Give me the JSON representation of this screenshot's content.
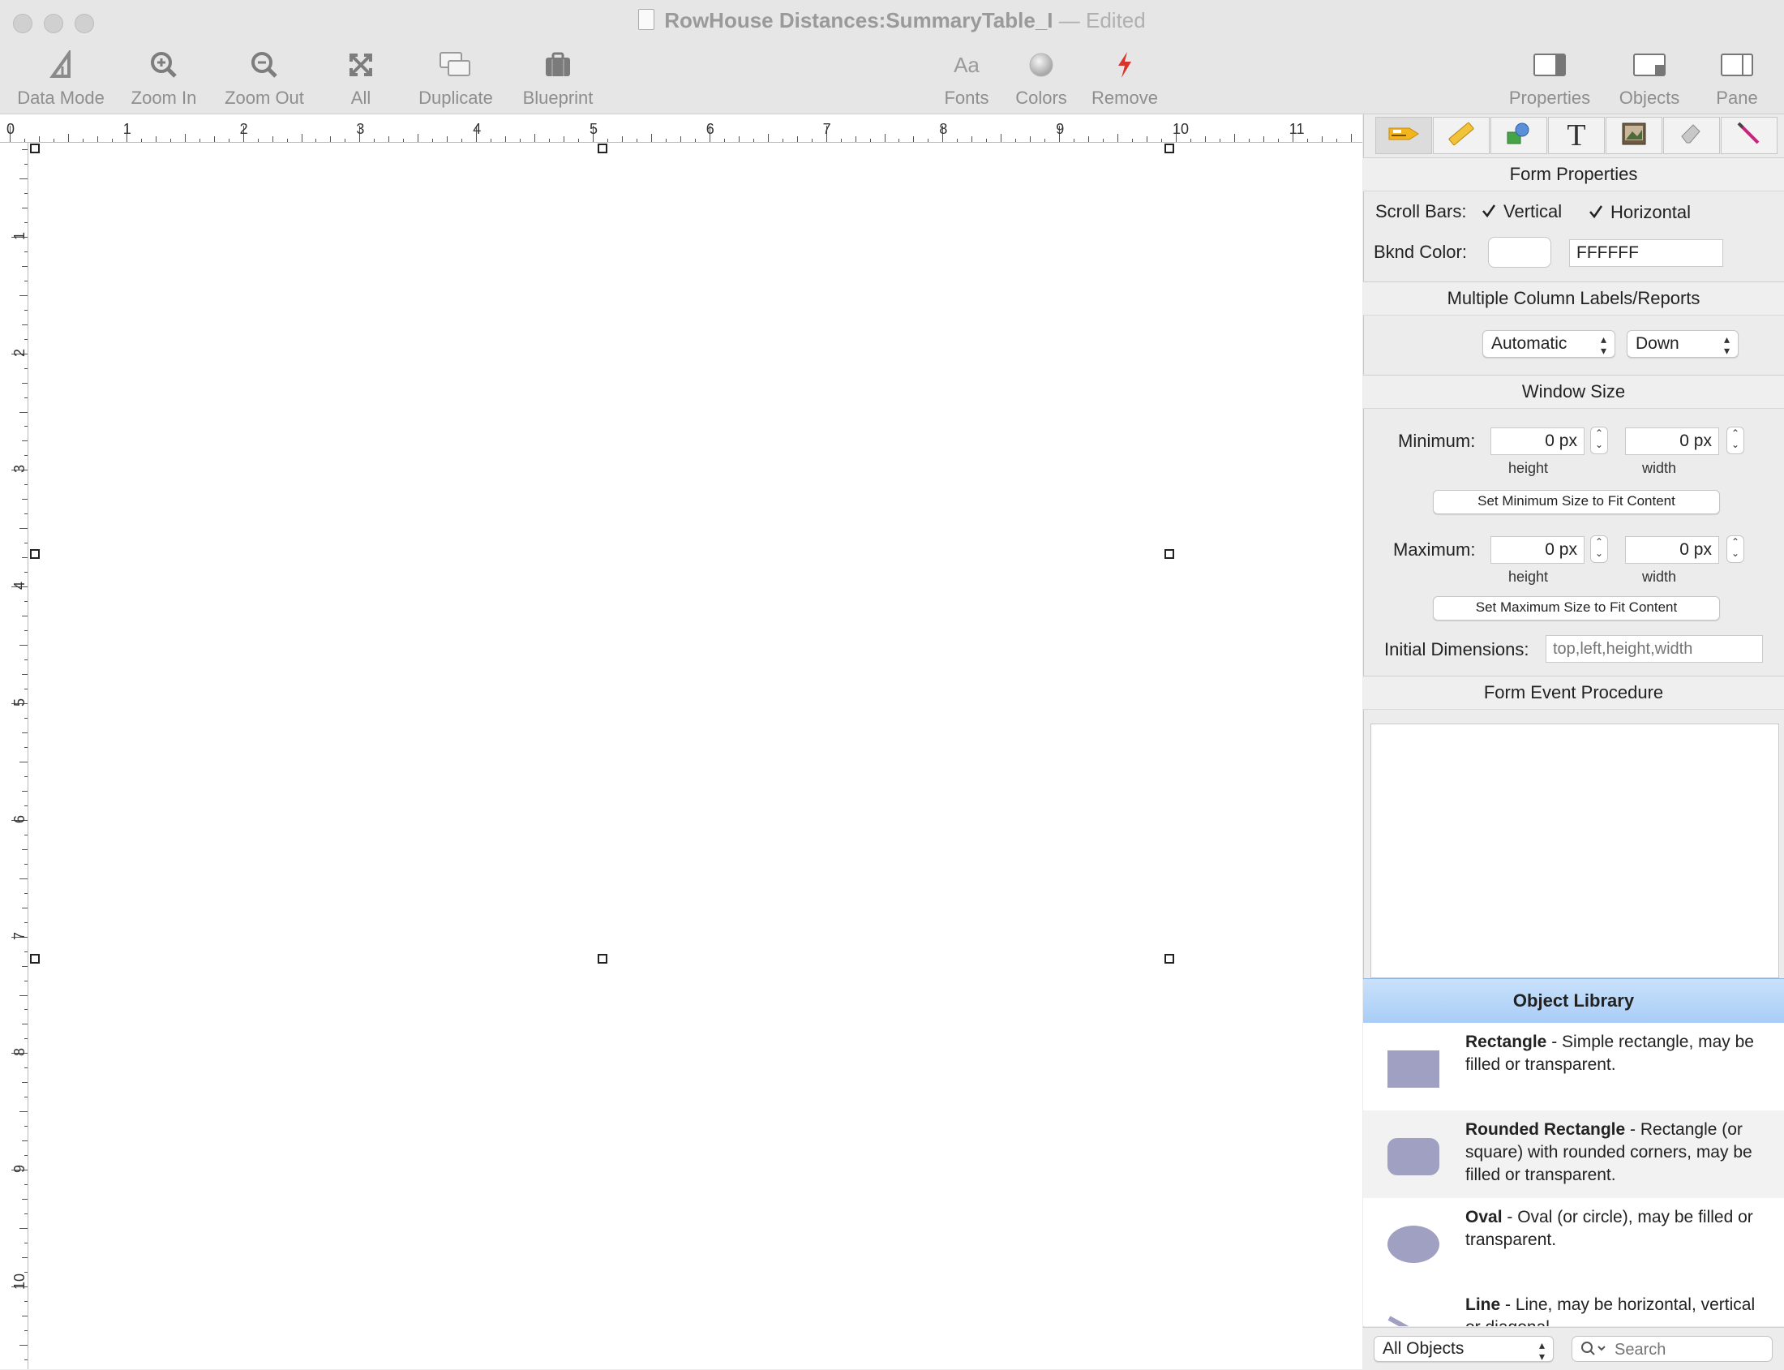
{
  "window": {
    "title": "RowHouse Distances:SummaryTable_I",
    "separator": "—",
    "status": "Edited"
  },
  "toolbar": {
    "left_items": [
      {
        "label": "Data Mode",
        "icon": "data-mode-icon"
      },
      {
        "label": "Zoom In",
        "icon": "zoom-in-icon"
      },
      {
        "label": "Zoom Out",
        "icon": "zoom-out-icon"
      },
      {
        "label": "All",
        "icon": "fit-all-icon"
      },
      {
        "label": "Duplicate",
        "icon": "duplicate-icon"
      },
      {
        "label": "Blueprint",
        "icon": "blueprint-icon"
      }
    ],
    "center_items": [
      {
        "label": "Fonts",
        "icon": "fonts-icon",
        "glyph": "Aa"
      },
      {
        "label": "Colors",
        "icon": "colors-icon"
      },
      {
        "label": "Remove",
        "icon": "remove-icon"
      }
    ],
    "right_items": [
      {
        "label": "Properties",
        "icon": "properties-pane-icon"
      },
      {
        "label": "Objects",
        "icon": "objects-pane-icon"
      },
      {
        "label": "Pane",
        "icon": "pane-icon"
      }
    ],
    "remove_color": "#d9342b"
  },
  "rulers": {
    "horizontal": [
      "0",
      "1",
      "2",
      "3",
      "4",
      "5",
      "6",
      "7",
      "8",
      "9",
      "10",
      "11"
    ],
    "vertical": [
      "1",
      "2",
      "3",
      "4",
      "5",
      "6",
      "7",
      "8",
      "9",
      "10"
    ]
  },
  "panel": {
    "tabs": [
      "form-tag-icon",
      "ruler-icon",
      "shapes-icon",
      "text-tool-icon",
      "image-tool-icon",
      "eraser-icon",
      "magic-wand-icon"
    ],
    "form_properties": {
      "header": "Form Properties",
      "scroll_bars_label": "Scroll Bars:",
      "vertical_label": "Vertical",
      "horizontal_label": "Horizontal",
      "vertical_checked": true,
      "horizontal_checked": true,
      "bknd_color_label": "Bknd Color:",
      "bknd_color_value": "FFFFFF",
      "bknd_swatch_color": "#FFFFFF"
    },
    "multi_column": {
      "header": "Multiple Column Labels/Reports",
      "layout_value": "Automatic",
      "direction_value": "Down"
    },
    "window_size": {
      "header": "Window Size",
      "minimum_label": "Minimum:",
      "maximum_label": "Maximum:",
      "min_height": "0 px",
      "min_width": "0 px",
      "max_height": "0 px",
      "max_width": "0 px",
      "height_caption": "height",
      "width_caption": "width",
      "set_min_button": "Set Minimum Size to Fit Content",
      "set_max_button": "Set Maximum Size to Fit Content",
      "initial_dimensions_label": "Initial Dimensions:",
      "initial_dimensions_placeholder": "top,left,height,width"
    },
    "event_procedure": {
      "header": "Form Event Procedure"
    },
    "object_library": {
      "header": "Object Library",
      "items": [
        {
          "name": "Rectangle",
          "desc": " - Simple rectangle, may be filled or transparent."
        },
        {
          "name": "Rounded Rectangle",
          "desc": " - Rectangle (or square) with rounded corners, may be filled or transparent."
        },
        {
          "name": "Oval",
          "desc": " - Oval (or circle), may be filled or transparent."
        },
        {
          "name": "Line",
          "desc": " - Line, may be horizontal, vertical or diagonal."
        }
      ]
    },
    "bottom": {
      "filter_value": "All Objects",
      "search_placeholder": "Search"
    }
  }
}
